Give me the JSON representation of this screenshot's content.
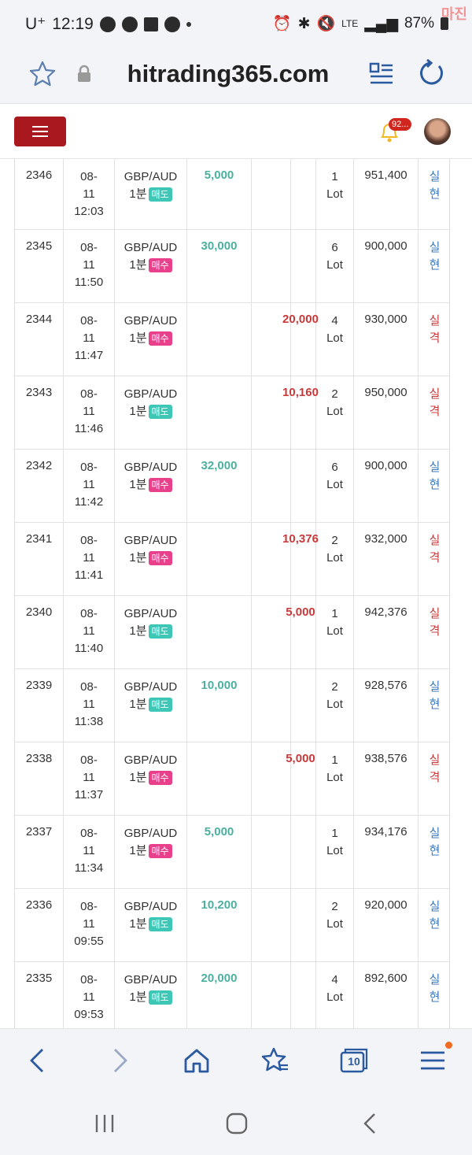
{
  "status_bar": {
    "carrier": "U⁺",
    "time": "12:19",
    "network": "LTE",
    "battery": "87%",
    "watermark": "마진"
  },
  "browser": {
    "url": "hitrading365.com",
    "tab_count": "10"
  },
  "header": {
    "notification_count": "92..."
  },
  "rows": [
    {
      "no": "2346",
      "d1": "08-",
      "d2": "11",
      "d3": "12:03",
      "pair": "GBP/AUD",
      "tf": "1분",
      "side": "매도",
      "side_type": "sell",
      "gain": "5,000",
      "loss": "",
      "lot1": "1",
      "lot2": "Lot",
      "balance": "951,400",
      "res1": "실",
      "res2": "현",
      "res_type": "win"
    },
    {
      "no": "2345",
      "d1": "08-",
      "d2": "11",
      "d3": "11:50",
      "pair": "GBP/AUD",
      "tf": "1분",
      "side": "매수",
      "side_type": "buy",
      "gain": "30,000",
      "loss": "",
      "lot1": "6",
      "lot2": "Lot",
      "balance": "900,000",
      "res1": "실",
      "res2": "현",
      "res_type": "win"
    },
    {
      "no": "2344",
      "d1": "08-",
      "d2": "11",
      "d3": "11:47",
      "pair": "GBP/AUD",
      "tf": "1분",
      "side": "매수",
      "side_type": "buy",
      "gain": "",
      "loss": "20,000",
      "lot1": "4",
      "lot2": "Lot",
      "balance": "930,000",
      "res1": "실",
      "res2": "격",
      "res_type": "loss"
    },
    {
      "no": "2343",
      "d1": "08-",
      "d2": "11",
      "d3": "11:46",
      "pair": "GBP/AUD",
      "tf": "1분",
      "side": "매도",
      "side_type": "sell",
      "gain": "",
      "loss": "10,160",
      "lot1": "2",
      "lot2": "Lot",
      "balance": "950,000",
      "res1": "실",
      "res2": "격",
      "res_type": "loss"
    },
    {
      "no": "2342",
      "d1": "08-",
      "d2": "11",
      "d3": "11:42",
      "pair": "GBP/AUD",
      "tf": "1분",
      "side": "매수",
      "side_type": "buy",
      "gain": "32,000",
      "loss": "",
      "lot1": "6",
      "lot2": "Lot",
      "balance": "900,000",
      "res1": "실",
      "res2": "현",
      "res_type": "win"
    },
    {
      "no": "2341",
      "d1": "08-",
      "d2": "11",
      "d3": "11:41",
      "pair": "GBP/AUD",
      "tf": "1분",
      "side": "매수",
      "side_type": "buy",
      "gain": "",
      "loss": "10,376",
      "lot1": "2",
      "lot2": "Lot",
      "balance": "932,000",
      "res1": "실",
      "res2": "격",
      "res_type": "loss"
    },
    {
      "no": "2340",
      "d1": "08-",
      "d2": "11",
      "d3": "11:40",
      "pair": "GBP/AUD",
      "tf": "1분",
      "side": "매도",
      "side_type": "sell",
      "gain": "",
      "loss": "5,000",
      "lot1": "1",
      "lot2": "Lot",
      "balance": "942,376",
      "res1": "실",
      "res2": "격",
      "res_type": "loss"
    },
    {
      "no": "2339",
      "d1": "08-",
      "d2": "11",
      "d3": "11:38",
      "pair": "GBP/AUD",
      "tf": "1분",
      "side": "매도",
      "side_type": "sell",
      "gain": "10,000",
      "loss": "",
      "lot1": "2",
      "lot2": "Lot",
      "balance": "928,576",
      "res1": "실",
      "res2": "현",
      "res_type": "win"
    },
    {
      "no": "2338",
      "d1": "08-",
      "d2": "11",
      "d3": "11:37",
      "pair": "GBP/AUD",
      "tf": "1분",
      "side": "매수",
      "side_type": "buy",
      "gain": "",
      "loss": "5,000",
      "lot1": "1",
      "lot2": "Lot",
      "balance": "938,576",
      "res1": "실",
      "res2": "격",
      "res_type": "loss"
    },
    {
      "no": "2337",
      "d1": "08-",
      "d2": "11",
      "d3": "11:34",
      "pair": "GBP/AUD",
      "tf": "1분",
      "side": "매수",
      "side_type": "buy",
      "gain": "5,000",
      "loss": "",
      "lot1": "1",
      "lot2": "Lot",
      "balance": "934,176",
      "res1": "실",
      "res2": "현",
      "res_type": "win"
    },
    {
      "no": "2336",
      "d1": "08-",
      "d2": "11",
      "d3": "09:55",
      "pair": "GBP/AUD",
      "tf": "1분",
      "side": "매도",
      "side_type": "sell",
      "gain": "10,200",
      "loss": "",
      "lot1": "2",
      "lot2": "Lot",
      "balance": "920,000",
      "res1": "실",
      "res2": "현",
      "res_type": "win"
    },
    {
      "no": "2335",
      "d1": "08-",
      "d2": "11",
      "d3": "09:53",
      "pair": "GBP/AUD",
      "tf": "1분",
      "side": "매도",
      "side_type": "sell",
      "gain": "20,000",
      "loss": "",
      "lot1": "4",
      "lot2": "Lot",
      "balance": "892,600",
      "res1": "실",
      "res2": "현",
      "res_type": "win"
    }
  ],
  "colors": {
    "brand_red": "#a8181e",
    "gain": "#4bb0a0",
    "loss": "#c83a3a",
    "sell_tag": "#3ec6b6",
    "buy_tag": "#e8408a",
    "win_text": "#3a7abf"
  }
}
